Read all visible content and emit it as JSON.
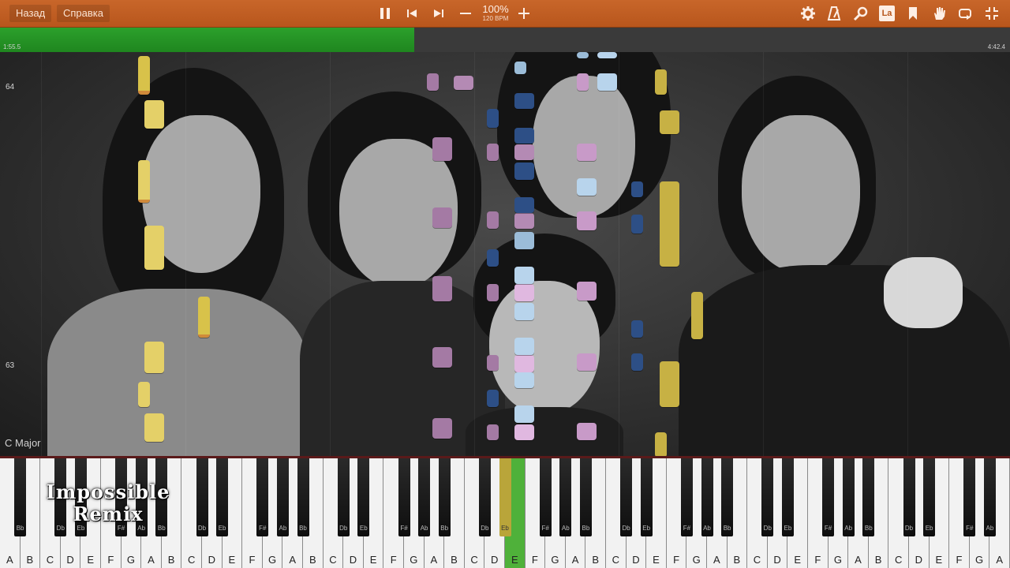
{
  "toolbar": {
    "back_label": "Назад",
    "help_label": "Справка",
    "speed_percent": "100%",
    "tempo": "120 BPM",
    "label_toggle": "La"
  },
  "playback": {
    "elapsed": "1:55.5",
    "total": "4:42.4",
    "progress_fraction": 0.41
  },
  "roll": {
    "octave_labels": [
      "64",
      "63"
    ],
    "key_signature": "C Major"
  },
  "overlay": {
    "logo_line1": "Impossible",
    "logo_line2": "Remix"
  },
  "keyboard": {
    "white_keys": [
      "A",
      "B",
      "C",
      "D",
      "E",
      "F",
      "G",
      "A",
      "B",
      "C",
      "D",
      "E",
      "F",
      "G",
      "A",
      "B",
      "C",
      "D",
      "E",
      "F",
      "G",
      "A",
      "B",
      "C",
      "D",
      "E",
      "F",
      "G",
      "A",
      "B",
      "C",
      "D",
      "E",
      "F",
      "G",
      "A",
      "B",
      "C",
      "D",
      "E",
      "F",
      "G",
      "A",
      "B",
      "C",
      "D",
      "E",
      "F",
      "G",
      "A"
    ],
    "black_key_labels": [
      "Bb",
      "Db",
      "Eb",
      "F#",
      "Ab",
      "Bb",
      "Db",
      "Eb",
      "F#",
      "Ab",
      "Bb",
      "Db",
      "Eb",
      "F#",
      "Ab",
      "Bb",
      "Db",
      "Eb",
      "F#",
      "Ab",
      "Bb",
      "Db",
      "Eb",
      "F#",
      "Ab",
      "Bb",
      "Db",
      "Eb",
      "F#",
      "Ab",
      "Bb",
      "Db",
      "Eb",
      "F#",
      "Ab",
      "Bb"
    ],
    "active_white_index": 25,
    "active_black_label_index": 17
  },
  "colors": {
    "toolbar": "#c0602a",
    "progress": "#28a028",
    "note_yellow": "#d8c24a",
    "note_pink": "#b07ab0",
    "note_blue": "#9bbcd8",
    "note_darkblue": "#2d4f86",
    "note_orange": "#d08a3a"
  }
}
